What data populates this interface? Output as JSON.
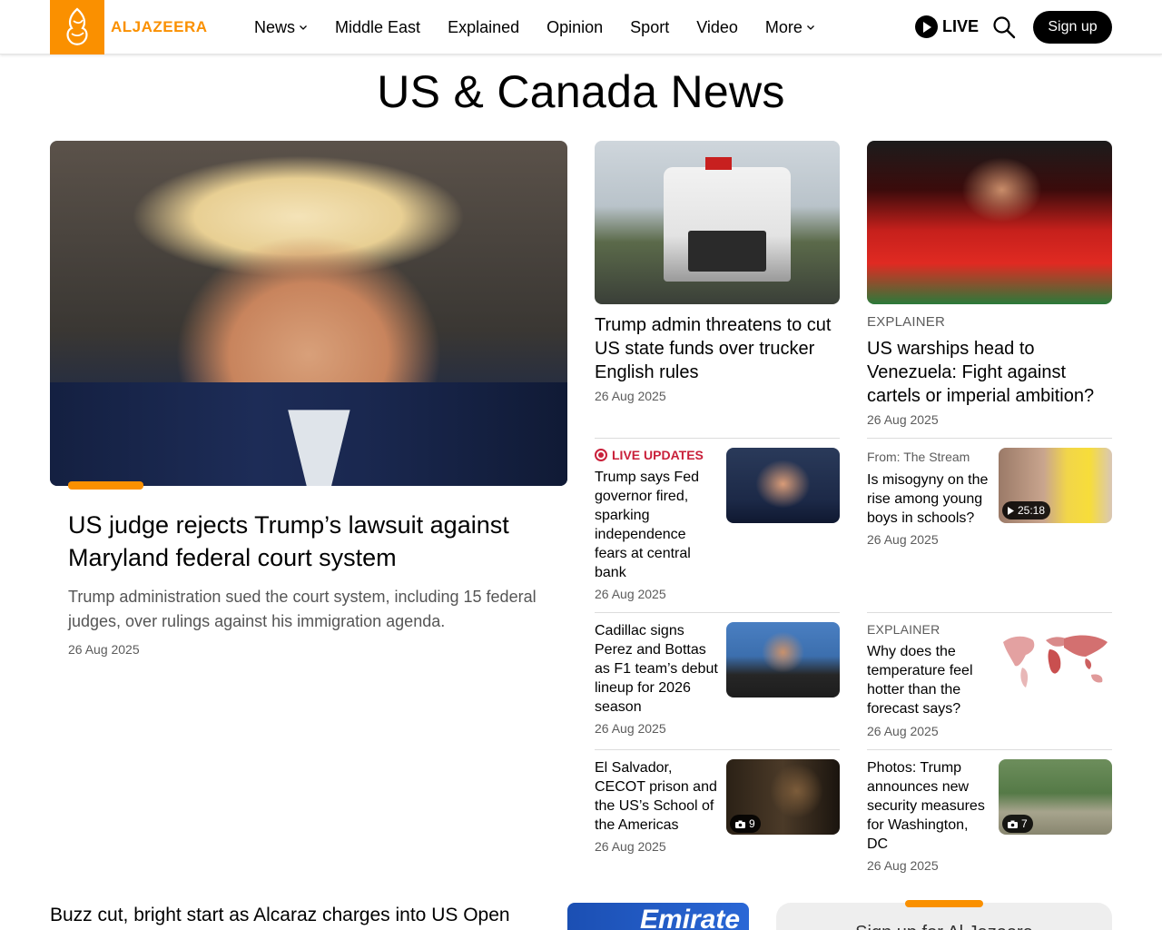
{
  "header": {
    "logo_text": "ALJAZEERA",
    "nav": [
      {
        "label": "News",
        "dropdown": true
      },
      {
        "label": "Middle East",
        "dropdown": false
      },
      {
        "label": "Explained",
        "dropdown": false
      },
      {
        "label": "Opinion",
        "dropdown": false
      },
      {
        "label": "Sport",
        "dropdown": false
      },
      {
        "label": "Video",
        "dropdown": false
      },
      {
        "label": "More",
        "dropdown": true
      }
    ],
    "live_label": "LIVE",
    "signup_label": "Sign up"
  },
  "page_title": "US & Canada News",
  "hero": {
    "title": "US judge rejects Trump’s lawsuit against Maryland federal court system",
    "description": "Trump administration sued the court system, including 15 federal judges, over rulings against his immigration agenda.",
    "date": "26 Aug 2025"
  },
  "cards": {
    "truckers": {
      "title": "Trump admin threatens to cut US state funds over trucker English rules",
      "date": "26 Aug 2025"
    },
    "venezuela": {
      "label": "EXPLAINER",
      "title": "US warships head to Venezuela: Fight against cartels or imperial ambition?",
      "date": "26 Aug 2025"
    },
    "fed": {
      "label": "LIVE UPDATES",
      "title": "Trump says Fed governor fired, sparking independence fears at central bank",
      "date": "26 Aug 2025"
    },
    "stream": {
      "from": "From: The Stream",
      "title": "Is misogyny on the rise among young boys in schools?",
      "date": "26 Aug 2025",
      "duration": "25:18"
    },
    "cadillac": {
      "title": "Cadillac signs Perez and Bottas as F1 team’s debut lineup for 2026 season",
      "date": "26 Aug 2025"
    },
    "temperature": {
      "label": "EXPLAINER",
      "title": "Why does the temperature feel hotter than the forecast says?",
      "date": "26 Aug 2025"
    },
    "cecot": {
      "title": "El Salvador, CECOT prison and the US’s School of the Americas",
      "date": "26 Aug 2025",
      "photo_count": "9"
    },
    "dc": {
      "title": "Photos: Trump announces new security measures for Washington, DC",
      "date": "26 Aug 2025",
      "photo_count": "7"
    }
  },
  "bottom": {
    "title": "Buzz cut, bright start as Alcaraz charges into US Open second",
    "image_text": "Emirate",
    "newsletter": "Sign up for Al Jazeera"
  },
  "colors": {
    "brand_orange": "#fa9000",
    "live_red": "#c9203a",
    "text_gray": "#5c5c5c"
  }
}
